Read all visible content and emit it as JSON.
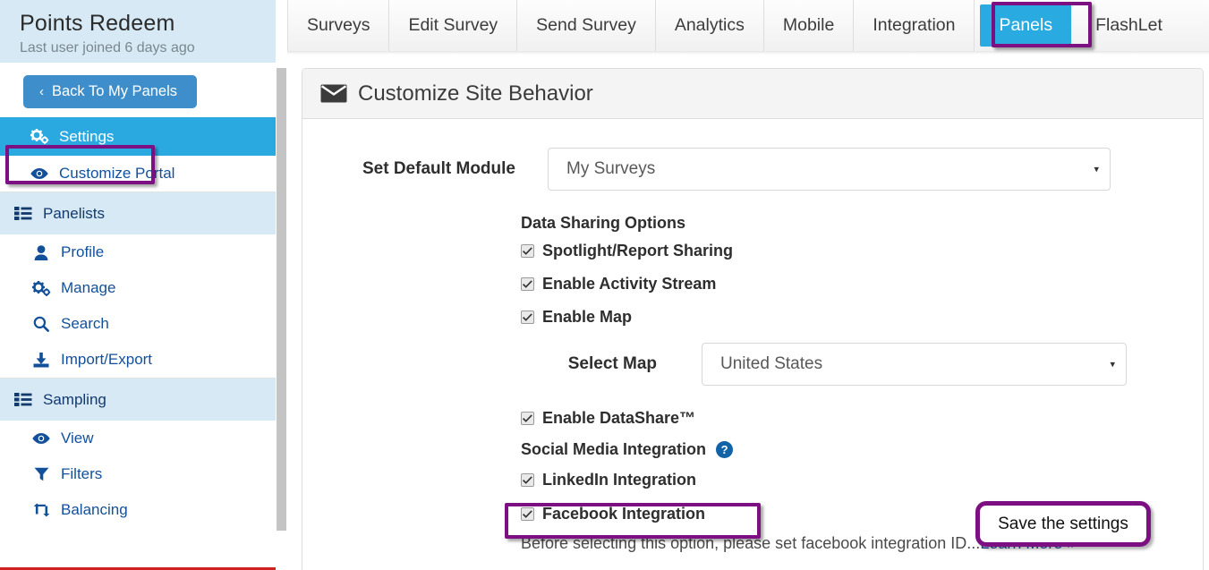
{
  "sidebar": {
    "panel_title": "Points Redeem",
    "panel_subtitle": "Last user joined 6 days ago",
    "back_button": "Back To My Panels",
    "back_chevron": "‹",
    "items": [
      {
        "label": "Settings",
        "icon": "gears-icon",
        "state": "active"
      },
      {
        "label": "Customize Portal",
        "icon": "eye-icon",
        "state": "sub"
      },
      {
        "label": "Panelists",
        "icon": "list-icon",
        "state": "group"
      },
      {
        "label": "Profile",
        "icon": "user-icon",
        "state": "sub"
      },
      {
        "label": "Manage",
        "icon": "gears-icon",
        "state": "sub"
      },
      {
        "label": "Search",
        "icon": "magnifier-icon",
        "state": "sub"
      },
      {
        "label": "Import/Export",
        "icon": "download-icon",
        "state": "sub"
      },
      {
        "label": "Sampling",
        "icon": "list-icon",
        "state": "group"
      },
      {
        "label": "View",
        "icon": "eye-icon",
        "state": "sub"
      },
      {
        "label": "Filters",
        "icon": "funnel-icon",
        "state": "sub"
      },
      {
        "label": "Balancing",
        "icon": "exchange-icon",
        "state": "sub"
      }
    ]
  },
  "tabs": {
    "items": [
      {
        "label": "Surveys",
        "selected": false
      },
      {
        "label": "Edit Survey",
        "selected": false
      },
      {
        "label": "Send Survey",
        "selected": false
      },
      {
        "label": "Analytics",
        "selected": false
      },
      {
        "label": "Mobile",
        "selected": false
      },
      {
        "label": "Integration",
        "selected": false
      },
      {
        "label": "Panels",
        "selected": true
      },
      {
        "label": "FlashLet",
        "selected": false
      }
    ]
  },
  "card": {
    "title": "Customize Site Behavior",
    "title_icon": "envelope-icon",
    "default_module": {
      "label": "Set Default Module",
      "value": "My Surveys",
      "caret": "▾"
    },
    "data_sharing_heading": "Data Sharing Options",
    "checkboxes": [
      {
        "label": "Spotlight/Report Sharing",
        "checked": true
      },
      {
        "label": "Enable Activity Stream",
        "checked": true
      },
      {
        "label": "Enable Map",
        "checked": true
      }
    ],
    "select_map": {
      "label": "Select Map",
      "value": "United States",
      "caret": "▾"
    },
    "datashare": {
      "label": "Enable DataShare™",
      "checked": true
    },
    "social_heading": "Social Media Integration",
    "social_help_icon": "question-mark-icon",
    "social_help_glyph": "?",
    "linkedin": {
      "label": "LinkedIn Integration",
      "checked": true
    },
    "facebook": {
      "label": "Facebook Integration",
      "checked": true
    },
    "facebook_note": "Before selecting this option, please set facebook integration ID...",
    "facebook_note_link": "Learn More »"
  },
  "annotations": {
    "accent_color": "#7c1083",
    "callout_text": "Save the settings",
    "highlighted": [
      "settings-sidebar-item",
      "panels-tab",
      "facebook-integration-checkbox"
    ]
  }
}
